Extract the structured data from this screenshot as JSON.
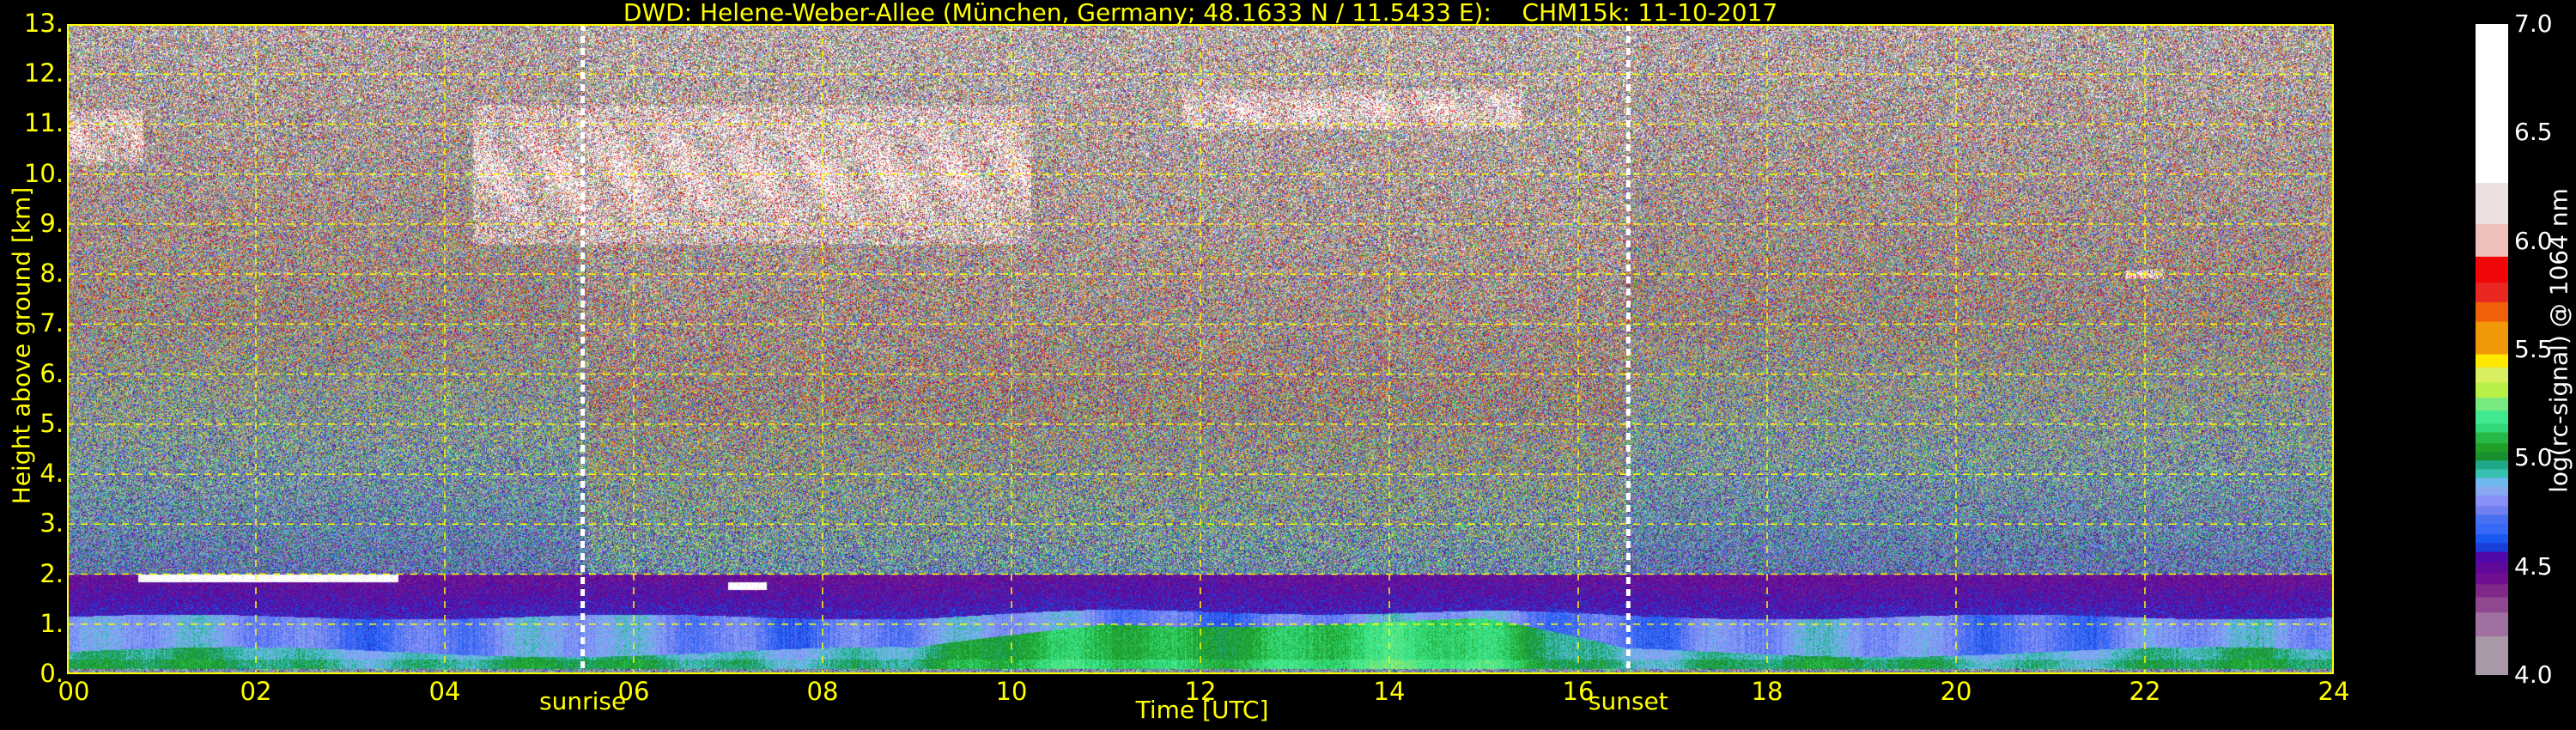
{
  "chart_data": {
    "type": "heatmap",
    "title": "DWD: Helene-Weber-Allee (München, Germany; 48.1633 N / 11.5433 E):    CHM15k: 11-10-2017",
    "xlabel": "Time [UTC]",
    "ylabel": "Height above ground [km]",
    "xlim": [
      0,
      24
    ],
    "ylim": [
      0,
      13
    ],
    "xticks": [
      "00",
      "02",
      "04",
      "06",
      "08",
      "10",
      "12",
      "14",
      "16",
      "18",
      "20",
      "22",
      "24"
    ],
    "xtick_values": [
      0,
      2,
      4,
      6,
      8,
      10,
      12,
      14,
      16,
      18,
      20,
      22,
      24
    ],
    "yticks": [
      "0.",
      "1.",
      "2.",
      "3.",
      "4.",
      "5.",
      "6.",
      "7.",
      "8.",
      "9.",
      "10.",
      "11.",
      "12.",
      "13."
    ],
    "ytick_values": [
      0,
      1,
      2,
      3,
      4,
      5,
      6,
      7,
      8,
      9,
      10,
      11,
      12,
      13
    ],
    "grid": true,
    "grid_color": "#ffff00",
    "annotations": [
      {
        "label": "sunrise",
        "x": 5.46
      },
      {
        "label": "sunset",
        "x": 16.53
      }
    ],
    "colorbar": {
      "label": "log(rc-signal) @ 1064 nm",
      "range": [
        4.0,
        7.0
      ],
      "ticks": [
        "4.0",
        "4.5",
        "5.0",
        "5.5",
        "6.0",
        "6.5",
        "7.0"
      ],
      "tick_values": [
        4.0,
        4.5,
        5.0,
        5.5,
        6.0,
        6.5,
        7.0
      ],
      "levels": [
        4.0,
        4.18,
        4.29,
        4.36,
        4.42,
        4.47,
        4.52,
        4.57,
        4.61,
        4.65,
        4.7,
        4.74,
        4.78,
        4.83,
        4.87,
        4.91,
        4.95,
        4.99,
        5.03,
        5.07,
        5.12,
        5.16,
        5.22,
        5.28,
        5.35,
        5.42,
        5.48,
        5.63,
        5.72,
        5.81,
        5.93,
        6.08,
        6.27,
        7.0
      ],
      "colors": [
        "#a898a8",
        "#a070a0",
        "#904890",
        "#802888",
        "#701090",
        "#600898",
        "#5008a8",
        "#1840d8",
        "#1858f0",
        "#3868f8",
        "#4870f0",
        "#7080f0",
        "#8890f8",
        "#88a8f0",
        "#70b8f0",
        "#38c0b0",
        "#20a888",
        "#189030",
        "#20a028",
        "#28b848",
        "#30d878",
        "#40e890",
        "#78e880",
        "#b8f048",
        "#d8f060",
        "#ffe800",
        "#f09808",
        "#f06008",
        "#e82820",
        "#f00808",
        "#f0c0bc",
        "#ece0e0",
        "#ffffff"
      ]
    },
    "features": [
      {
        "kind": "cirrus",
        "t": [
          0.0,
          0.8
        ],
        "h": [
          10.2,
          11.3
        ]
      },
      {
        "kind": "cirrus",
        "t": [
          4.3,
          10.2
        ],
        "h": [
          8.6,
          11.4
        ]
      },
      {
        "kind": "cirrus",
        "t": [
          11.8,
          15.4
        ],
        "h": [
          10.9,
          11.7
        ]
      },
      {
        "kind": "cloud",
        "t": [
          21.8,
          22.2
        ],
        "h": [
          7.9,
          8.1
        ]
      },
      {
        "kind": "low-cloud",
        "t": [
          0.75,
          3.5
        ],
        "h": [
          1.85,
          2.0
        ]
      },
      {
        "kind": "low-cloud",
        "t": [
          7.0,
          7.4
        ],
        "h": [
          1.7,
          1.85
        ]
      }
    ]
  }
}
